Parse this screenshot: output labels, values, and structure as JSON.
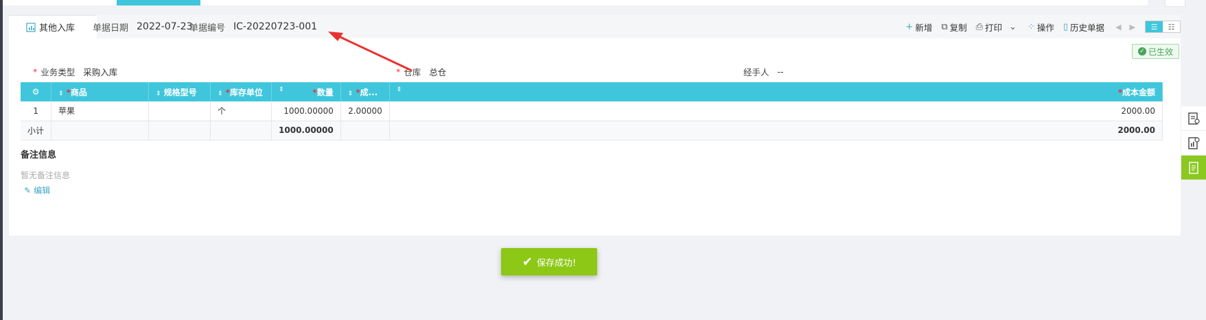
{
  "doc_tab": {
    "label": "其他入库",
    "icon": "chart-doc-icon"
  },
  "header": {
    "date_label": "单据日期",
    "date_value": "2022-07-23",
    "no_label": "单据编号",
    "no_value": "IC-20220723-001"
  },
  "toolbar": {
    "new_label": "新增",
    "copy_label": "复制",
    "print_label": "打印",
    "ops_label": "操作",
    "history_label": "历史单据"
  },
  "status": {
    "label": "已生效",
    "color": "#4aa35a"
  },
  "form": {
    "biz_type_label": "业务类型",
    "biz_type_value": "采购入库",
    "warehouse_label": "仓库",
    "warehouse_value": "总仓",
    "handler_label": "经手人",
    "handler_value": "--"
  },
  "table": {
    "headers": {
      "product": "商品",
      "spec": "规格型号",
      "unit": "库存单位",
      "qty": "数量",
      "cost": "成...",
      "amount": "成本金额"
    },
    "rows": [
      {
        "idx": "1",
        "product": "苹果",
        "spec": "",
        "unit": "个",
        "qty": "1000.00000",
        "cost": "2.00000",
        "amount": "2000.00"
      }
    ],
    "subtotal": {
      "label": "小计",
      "qty": "1000.00000",
      "amount": "2000.00"
    }
  },
  "notes": {
    "title": "备注信息",
    "empty": "暂无备注信息",
    "edit_label": "编辑"
  },
  "toast": {
    "message": "保存成功!"
  },
  "colors": {
    "accent": "#3fc6dc",
    "success": "#8dc816",
    "required": "#e0393e",
    "annotation": "#e8322f"
  }
}
